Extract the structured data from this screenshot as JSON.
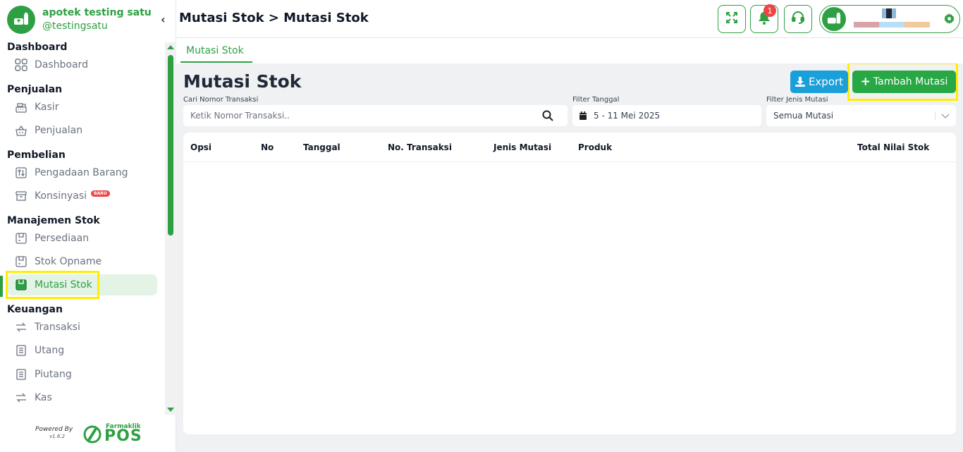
{
  "brand": {
    "name": "apotek testing satu",
    "handle": "@testingsatu"
  },
  "colors": {
    "primary": "#2ea043",
    "export": "#1a9fd9",
    "add": "#28a745",
    "badge": "#ef4444",
    "highlight": "#ffee00"
  },
  "sidebar": {
    "groups": [
      {
        "title": "Dashboard",
        "items": [
          {
            "label": "Dashboard",
            "icon": "grid-icon"
          }
        ]
      },
      {
        "title": "Penjualan",
        "items": [
          {
            "label": "Kasir",
            "icon": "cash-register-icon"
          },
          {
            "label": "Penjualan",
            "icon": "basket-icon"
          }
        ]
      },
      {
        "title": "Pembelian",
        "items": [
          {
            "label": "Pengadaan Barang",
            "icon": "box-sort-icon"
          },
          {
            "label": "Konsinyasi",
            "icon": "archive-icon",
            "badge": "BARU"
          }
        ]
      },
      {
        "title": "Manajemen Stok",
        "items": [
          {
            "label": "Persediaan",
            "icon": "stock-box-icon"
          },
          {
            "label": "Stok Opname",
            "icon": "stock-box-icon"
          },
          {
            "label": "Mutasi Stok",
            "icon": "stock-box-icon",
            "active": true
          }
        ]
      },
      {
        "title": "Keuangan",
        "items": [
          {
            "label": "Transaksi",
            "icon": "exchange-icon"
          },
          {
            "label": "Utang",
            "icon": "receipt-icon"
          },
          {
            "label": "Piutang",
            "icon": "receipt-icon"
          },
          {
            "label": "Kas",
            "icon": "exchange-icon"
          }
        ]
      }
    ]
  },
  "powered": {
    "by": "Powered By",
    "version": "v1.6.2",
    "product_name": "Farmaklik",
    "product_pos": "POS"
  },
  "header": {
    "title": "Mutasi Stok > Mutasi Stok",
    "notification_count": "1"
  },
  "tabs": [
    {
      "label": "Mutasi Stok",
      "active": true
    }
  ],
  "content": {
    "title": "Mutasi Stok",
    "export_label": "Export",
    "add_label": "Tambah Mutasi",
    "filters": {
      "search_label": "Cari Nomor Transaksi",
      "search_placeholder": "Ketik Nomor Transaksi..",
      "date_label": "Filter Tanggal",
      "date_value": "5 - 11 Mei 2025",
      "type_label": "Filter Jenis Mutasi",
      "type_value": "Semua Mutasi"
    },
    "table": {
      "columns": [
        "Opsi",
        "No",
        "Tanggal",
        "No. Transaksi",
        "Jenis Mutasi",
        "Produk",
        "Total Nilai Stok"
      ],
      "rows": []
    }
  }
}
